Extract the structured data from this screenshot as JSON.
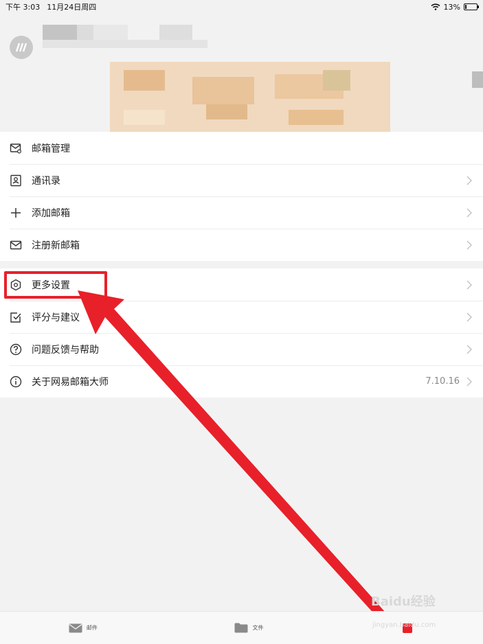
{
  "status_bar": {
    "time": "下午 3:03",
    "date": "11月24日周四",
    "battery": "13%",
    "battery_level": 0.13
  },
  "menu_group_1": [
    {
      "name": "mailbox-manage",
      "label": "邮箱管理",
      "icon": "mail-manage-icon"
    },
    {
      "name": "contacts",
      "label": "通讯录",
      "icon": "contacts-icon"
    },
    {
      "name": "add-mailbox",
      "label": "添加邮箱",
      "icon": "plus-icon"
    },
    {
      "name": "register-mailbox",
      "label": "注册新邮箱",
      "icon": "mail-icon"
    }
  ],
  "menu_group_2": [
    {
      "name": "more-settings",
      "label": "更多设置",
      "icon": "settings-icon"
    },
    {
      "name": "rate-suggest",
      "label": "评分与建议",
      "icon": "check-square-icon"
    },
    {
      "name": "help-feedback",
      "label": "问题反馈与帮助",
      "icon": "question-icon"
    },
    {
      "name": "about",
      "label": "关于网易邮箱大师",
      "icon": "info-icon",
      "value": "7.10.16"
    }
  ],
  "tabbar": {
    "mail_label": "邮件",
    "files_label": "文件"
  },
  "watermark": {
    "text": "Baidu经验",
    "sub": "jingyan.baidu.com"
  },
  "colors": {
    "annotation_red": "#e8202a",
    "background": "#f2f2f2"
  }
}
